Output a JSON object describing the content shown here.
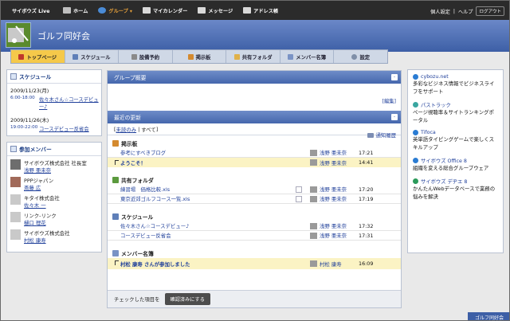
{
  "topbar": {
    "brand": "サイボウズ Live",
    "nav": [
      {
        "label": "ホーム",
        "icon": "home-icon",
        "active": false
      },
      {
        "label": "グループ ▾",
        "icon": "group-icon",
        "active": true
      },
      {
        "label": "マイカレンダー",
        "icon": "calendar-icon",
        "active": false
      },
      {
        "label": "メッセージ",
        "icon": "message-icon",
        "active": false
      },
      {
        "label": "アドレス帳",
        "icon": "addressbook-icon",
        "active": false
      }
    ],
    "settings": "個人設定",
    "separator": "|",
    "help": "ヘルプ",
    "logout": "ログアウト"
  },
  "group": {
    "title": "ゴルフ同好会",
    "footer_tab": "ゴルフ同好会"
  },
  "tabs": [
    {
      "label": "トップページ",
      "icon": "home-icon",
      "active": true
    },
    {
      "label": "スケジュール",
      "icon": "calendar-icon",
      "active": false
    },
    {
      "label": "設備予約",
      "icon": "facility-icon",
      "active": false
    },
    {
      "label": "掲示板",
      "icon": "board-icon",
      "active": false
    },
    {
      "label": "共有フォルダ",
      "icon": "folder-icon",
      "active": false
    },
    {
      "label": "メンバー名簿",
      "icon": "members-icon",
      "active": false
    },
    {
      "label": "設定",
      "icon": "gear-icon",
      "active": false
    }
  ],
  "schedule_panel": {
    "title": "スケジュール",
    "days": [
      {
        "date": "2009/11/23(月)",
        "time": "6:00-18:00",
        "event": "佐々木さん☆コースデビュー♪"
      },
      {
        "date": "2009/11/26(木)",
        "time": "19:00-22:00",
        "event": "コースデビュー反省会"
      }
    ]
  },
  "members_panel": {
    "title": "参加メンバー",
    "members": [
      {
        "company": "サイボウズ株式会社 社長室",
        "name": "浅野 亜未奈"
      },
      {
        "company": "PPPジャパン",
        "name": "斎藤 広"
      },
      {
        "company": "キタイ株式会社",
        "name": "佐々木 一"
      },
      {
        "company": "リンク-リンク",
        "name": "樋口 理花"
      },
      {
        "company": "サイボウズ株式会社",
        "name": "村松 康寿"
      }
    ]
  },
  "overview": {
    "title": "グループ概要",
    "collapse": "-",
    "edit": "[編集]"
  },
  "recent": {
    "title": "最近の更新",
    "collapse": "-",
    "filter_unread": "未読のみ",
    "filter_sep": "|",
    "filter_all": "すべて",
    "history": "通知履歴",
    "sections": [
      {
        "title": "掲示板",
        "icon": "board-icon",
        "items": [
          {
            "title": "参考にすべきブログ",
            "user": "浅野 亜未奈",
            "time": "17:21",
            "highlight": false,
            "download": false,
            "check": false
          },
          {
            "title": "ようこそ！",
            "user": "浅野 亜未奈",
            "time": "14:41",
            "highlight": true,
            "download": false,
            "check": true
          }
        ]
      },
      {
        "title": "共有フォルダ",
        "icon": "folder-icon",
        "items": [
          {
            "title": "練習場　価格比較.xls",
            "user": "浅野 亜未奈",
            "time": "17:20",
            "highlight": false,
            "download": true,
            "check": false
          },
          {
            "title": "東京近郊ゴルフコース一覧.xls",
            "user": "浅野 亜未奈",
            "time": "17:19",
            "highlight": false,
            "download": true,
            "check": false
          }
        ]
      },
      {
        "title": "スケジュール",
        "icon": "calendar-icon",
        "items": [
          {
            "title": "佐々木さん☆コースデビュー♪",
            "user": "浅野 亜未奈",
            "time": "17:32",
            "highlight": false,
            "download": false,
            "check": false
          },
          {
            "title": "コースデビュー反省会",
            "user": "浅野 亜未奈",
            "time": "17:31",
            "highlight": false,
            "download": false,
            "check": false
          }
        ]
      },
      {
        "title": "メンバー名簿",
        "icon": "members-icon",
        "items": [
          {
            "title": "村松 康寿 さんが参加しました",
            "user": "村松 康寿",
            "time": "16:09",
            "highlight": true,
            "download": false,
            "check": true
          }
        ]
      }
    ],
    "action_label": "チェックした項目を",
    "action_button": "確認済みにする"
  },
  "ads": [
    {
      "source": "cybozu.net",
      "text": "多彩なビジネス情報でビジネスライフをサポート",
      "color": "#2b7cd3"
    },
    {
      "source": "パストラック",
      "text": "ページ視聴率＆サイトランキングポータル",
      "color": "#3aa6a0"
    },
    {
      "source": "Tifoca",
      "text": "英単語タイピングゲームで楽しくスキルアップ",
      "color": "#2b7cd3"
    },
    {
      "source": "サイボウズ Office 8",
      "text": "組織を変える総合グループウェア",
      "color": "#2b7cd3"
    },
    {
      "source": "サイボウズ デヂエ 8",
      "text": "かんたんWebデータベースで業務の悩みを解決",
      "color": "#2b9a5a"
    }
  ],
  "colors": {
    "accent": "#f5c94a",
    "header": "#4567ad",
    "link": "#1f3f9a",
    "highlight": "#fbf3c4"
  }
}
